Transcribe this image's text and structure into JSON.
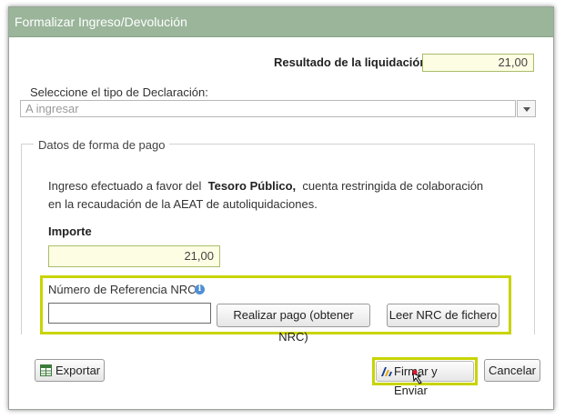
{
  "dialog": {
    "title": "Formalizar Ingreso/Devolución"
  },
  "liquidacion": {
    "label": "Resultado de la liquidación",
    "value": "21,00"
  },
  "tipo_declaracion": {
    "label": "Seleccione el tipo de Declaración:",
    "placeholder": "A ingresar"
  },
  "forma_pago": {
    "legend": "Datos de forma de pago",
    "text_before": "Ingreso efectuado a favor del",
    "text_bold": "Tesoro Público,",
    "text_after": "cuenta restringida de colaboración",
    "text_line2": "en la recaudación de la AEAT de autoliquidaciones.",
    "importe_label": "Importe",
    "importe_value": "21,00",
    "nrc_label": "Número de Referencia  NRC:",
    "nrc_value": "",
    "realizar_pago_button": "Realizar pago (obtener NRC)",
    "leer_nrc_button": "Leer NRC de fichero"
  },
  "footer": {
    "exportar_button": "Exportar",
    "firmar_button": "Firmar y Enviar",
    "cancelar_button": "Cancelar"
  },
  "colors": {
    "titlebar": "#9ab59a",
    "highlight": "#c8d400",
    "field_bg": "#fdfde4",
    "info_icon": "#4f8fd4"
  },
  "icons": {
    "exportar": "export-spreadsheet-icon",
    "firmar": "aeat-logo-icon",
    "info": "info-icon",
    "dropdown": "chevron-down-icon",
    "cursor": "mouse-pointer-icon"
  }
}
